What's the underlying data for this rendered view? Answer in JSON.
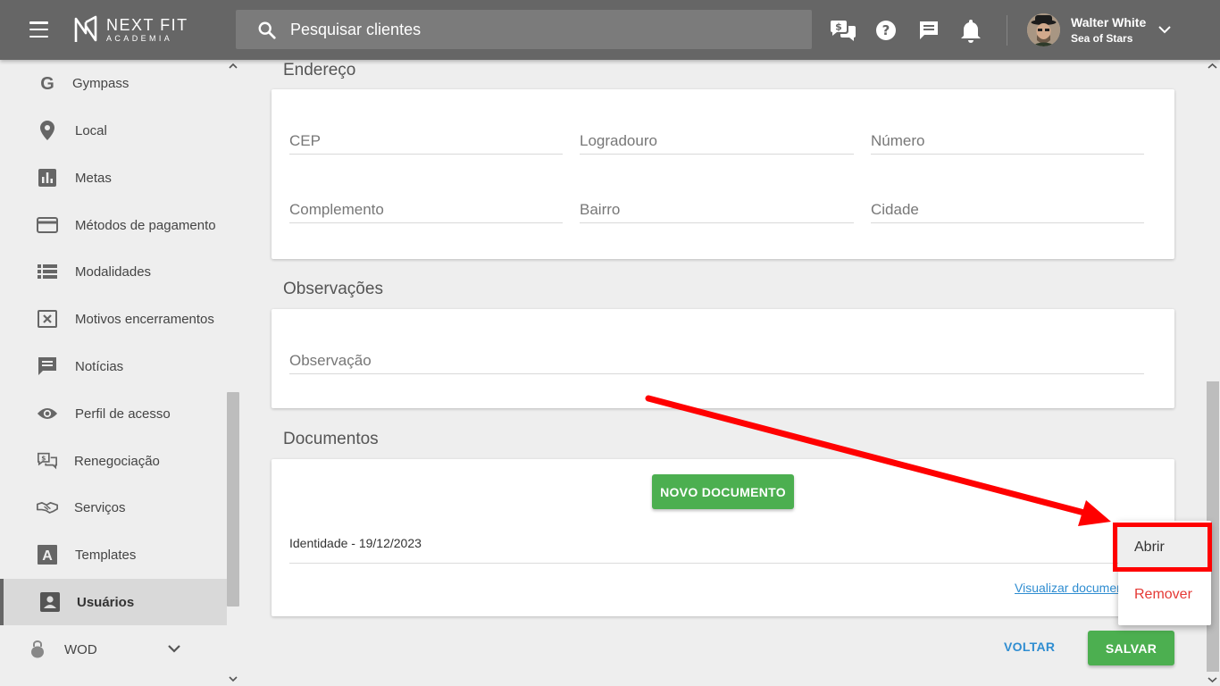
{
  "header": {
    "logo_line1": "NEXT FIT",
    "logo_line2": "ACADEMIA",
    "search_placeholder": "Pesquisar clientes",
    "user_name": "Walter White",
    "user_subtitle": "Sea of Stars"
  },
  "sidebar": {
    "items": [
      {
        "label": "Gympass",
        "icon": "google-icon"
      },
      {
        "label": "Local",
        "icon": "location-pin-icon"
      },
      {
        "label": "Metas",
        "icon": "bar-chart-icon"
      },
      {
        "label": "Métodos de pagamento",
        "icon": "credit-card-icon"
      },
      {
        "label": "Modalidades",
        "icon": "list-icon"
      },
      {
        "label": "Motivos encerramentos",
        "icon": "close-box-icon"
      },
      {
        "label": "Notícias",
        "icon": "message-icon"
      },
      {
        "label": "Perfil de acesso",
        "icon": "eye-icon"
      },
      {
        "label": "Renegociação",
        "icon": "renegotiation-icon"
      },
      {
        "label": "Serviços",
        "icon": "handshake-icon"
      },
      {
        "label": "Templates",
        "icon": "template-icon"
      },
      {
        "label": "Usuários",
        "icon": "user-box-icon",
        "active": true
      },
      {
        "label": "WOD",
        "icon": "kettlebell-icon"
      }
    ]
  },
  "sections": {
    "address_title": "Endereço",
    "address_fields": {
      "cep": "CEP",
      "logradouro": "Logradouro",
      "numero": "Número",
      "complemento": "Complemento",
      "bairro": "Bairro",
      "cidade": "Cidade"
    },
    "notes_title": "Observações",
    "notes_field": "Observação",
    "documents_title": "Documentos",
    "new_document_button": "NOVO DOCUMENTO",
    "document_item": "Identidade - 19/12/2023",
    "view_documents_link": "Visualizar documentos"
  },
  "footer": {
    "back_button": "VOLTAR",
    "save_button": "SALVAR"
  },
  "context_menu": {
    "open": "Abrir",
    "remove": "Remover"
  },
  "colors": {
    "topbar": "#666666",
    "primary_green": "#4caf50",
    "link_blue": "#2f8dd1",
    "danger_red": "#e53935",
    "annotation_red": "#ff0000"
  }
}
